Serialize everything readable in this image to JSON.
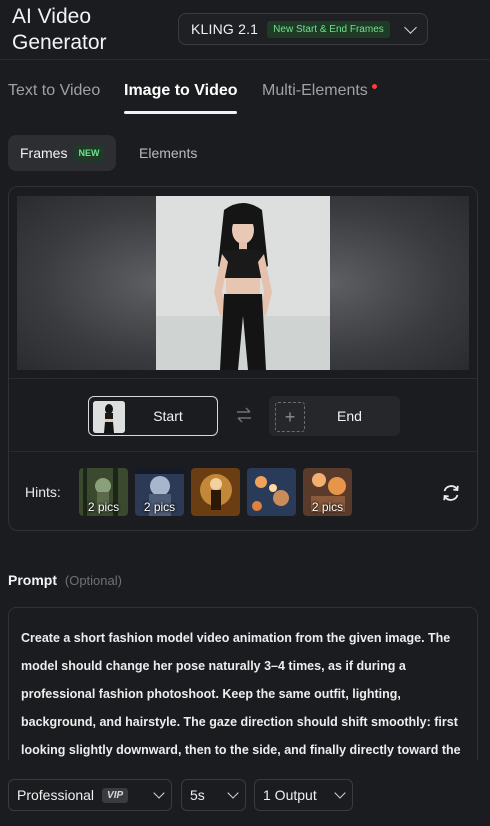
{
  "header": {
    "app_title": "AI Video Generator",
    "model": {
      "name": "KLING 2.1",
      "badge": "New Start & End Frames"
    }
  },
  "tabs": [
    {
      "label": "Text to Video",
      "active": false
    },
    {
      "label": "Image to Video",
      "active": true
    },
    {
      "label": "Multi-Elements",
      "active": false,
      "notification_dot": true
    }
  ],
  "subtabs": [
    {
      "label": "Frames",
      "badge": "NEW",
      "active": true
    },
    {
      "label": "Elements",
      "active": false
    }
  ],
  "frames": {
    "start_label": "Start",
    "end_label": "End",
    "swap_icon": "swap-arrows-icon",
    "add_icon": "plus-icon"
  },
  "hints": {
    "label": "Hints:",
    "items": [
      {
        "caption": "2 pics",
        "palette": [
          "#3b4a2e",
          "#8aa07a",
          "#1d2418"
        ]
      },
      {
        "caption": "2 pics",
        "palette": [
          "#2c3a55",
          "#a7b6cc",
          "#141a26"
        ]
      },
      {
        "caption": "",
        "palette": [
          "#6b3d12",
          "#e8a64a",
          "#2a1706"
        ]
      },
      {
        "caption": "",
        "palette": [
          "#2a3b5a",
          "#f0a25a",
          "#141c2c"
        ]
      },
      {
        "caption": "2 pics",
        "palette": [
          "#5a3a2a",
          "#f1b070",
          "#2a1a12"
        ]
      }
    ],
    "refresh_icon": "refresh-icon"
  },
  "prompt": {
    "title": "Prompt",
    "optional": "(Optional)",
    "text": "Create a short fashion model video animation from the given image.  The model should change her pose naturally 3–4 times, as if during a professional fashion photoshoot.  Keep the same outfit, lighting, background, and hairstyle.  The gaze direction should shift smoothly: first looking slightly downward, then to the side, and finally directly toward the"
  },
  "settings": {
    "mode": {
      "value": "Professional",
      "badge": "VIP"
    },
    "duration": {
      "value": "5s"
    },
    "outputs": {
      "value": "1 Output"
    }
  },
  "colors": {
    "background": "#1b1c1f",
    "accent_green": "#6ee38d",
    "notification_red": "#ff3b3b"
  }
}
